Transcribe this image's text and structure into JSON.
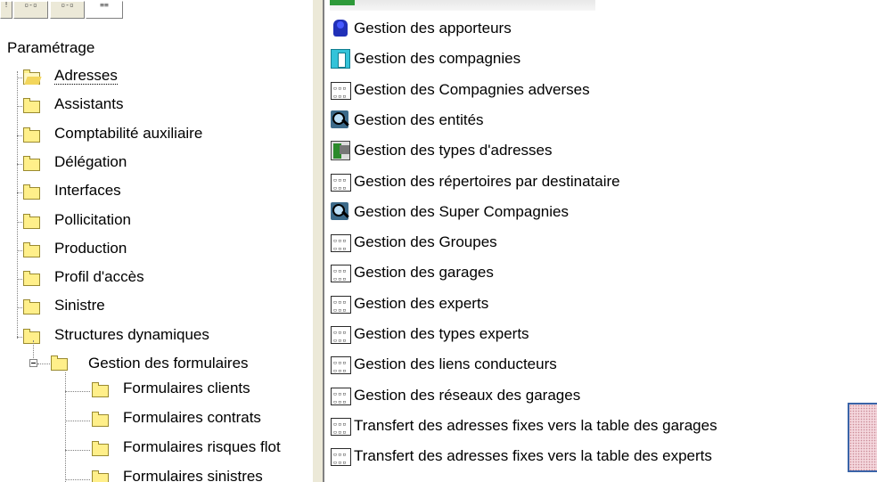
{
  "left_pane": {
    "toolbar_buttons": [
      {
        "glyph": "!",
        "icon": "large-icons-view-icon"
      },
      {
        "glyph": "▫-▫",
        "icon": "small-icons-view-icon"
      },
      {
        "glyph": "▫-▫",
        "icon": "list-view-icon"
      },
      {
        "glyph": "≡≡",
        "icon": "details-view-icon"
      }
    ],
    "root_label": "Paramétrage",
    "folders": [
      {
        "label": "Adresses",
        "open": true,
        "selected": true
      },
      {
        "label": "Assistants"
      },
      {
        "label": "Comptabilité auxiliaire"
      },
      {
        "label": "Délégation"
      },
      {
        "label": "Interfaces"
      },
      {
        "label": "Pollicitation"
      },
      {
        "label": "Production"
      },
      {
        "label": "Profil d'accès"
      },
      {
        "label": "Sinistre"
      },
      {
        "label": "Structures dynamiques"
      }
    ],
    "subfolder": {
      "label": "Gestion des formulaires",
      "expanded": true
    },
    "subfolder_children": [
      {
        "label": "Formulaires clients"
      },
      {
        "label": "Formulaires contrats"
      },
      {
        "label": "Formulaires risques flot"
      },
      {
        "label": "Formulaires sinistres"
      }
    ]
  },
  "right_pane": {
    "items": [
      {
        "label": "Gestion des apporteurs",
        "icon": "people-icon"
      },
      {
        "label": "Gestion des compagnies",
        "icon": "building-icon"
      },
      {
        "label": "Gestion des Compagnies adverses",
        "icon": "form-icon"
      },
      {
        "label": "Gestion des entités",
        "icon": "search-icon"
      },
      {
        "label": "Gestion des types d'adresses",
        "icon": "address-types-icon"
      },
      {
        "label": "Gestion des répertoires par destinataire",
        "icon": "form-icon"
      },
      {
        "label": "Gestion des Super Compagnies",
        "icon": "search-icon"
      },
      {
        "label": "Gestion des Groupes",
        "icon": "form-icon"
      },
      {
        "label": "Gestion des garages",
        "icon": "form-icon"
      },
      {
        "label": "Gestion des experts",
        "icon": "form-icon"
      },
      {
        "label": "Gestion des types experts",
        "icon": "form-icon"
      },
      {
        "label": "Gestion des liens conducteurs",
        "icon": "form-icon"
      },
      {
        "label": "Gestion des réseaux des garages",
        "icon": "form-icon"
      },
      {
        "label": "Transfert des adresses fixes vers la table des garages",
        "icon": "form-icon"
      },
      {
        "label": "Transfert des adresses fixes vers la table des experts",
        "icon": "form-icon"
      }
    ]
  }
}
